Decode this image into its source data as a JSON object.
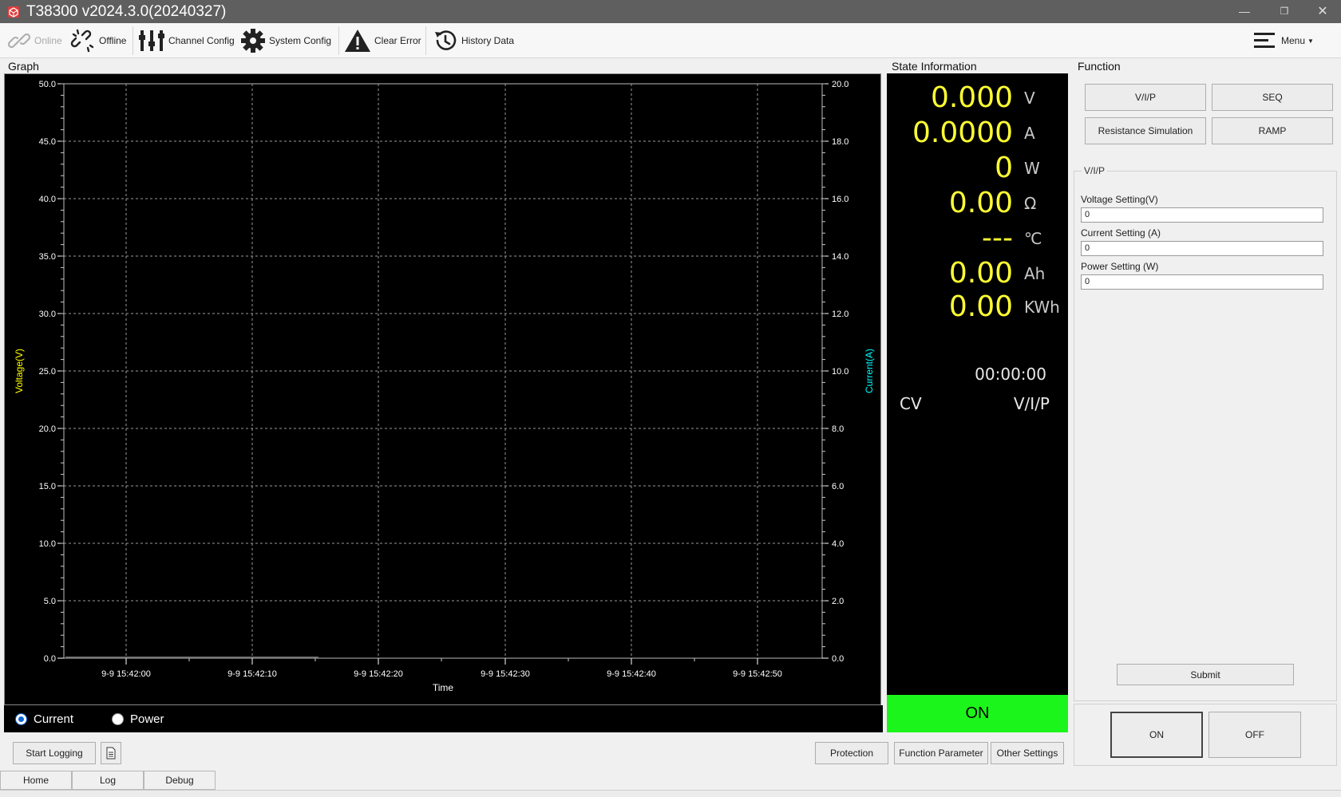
{
  "window": {
    "title": "T38300 v2024.3.0(20240327)",
    "controls": [
      "minimize-icon",
      "restore-icon",
      "close-icon"
    ]
  },
  "toolbar": {
    "online": "Online",
    "offline": "Offline",
    "channel_config": "Channel Config",
    "system_config": "System Config",
    "clear_error": "Clear Error",
    "history_data": "History Data",
    "menu": "Menu"
  },
  "sections": {
    "graph": "Graph",
    "state": "State Information",
    "function": "Function"
  },
  "chart_data": {
    "type": "line",
    "xlabel": "Time",
    "ylabel_left": "Voltage(V)",
    "ylabel_right": "Current(A)",
    "ylim_left": [
      0,
      50
    ],
    "ylim_right": [
      0,
      20
    ],
    "yticks_left": [
      "50.0",
      "45.0",
      "40.0",
      "35.0",
      "30.0",
      "25.0",
      "20.0",
      "15.0",
      "10.0",
      "5.0",
      "0.0"
    ],
    "yticks_right": [
      "20.0",
      "18.0",
      "16.0",
      "14.0",
      "12.0",
      "10.0",
      "8.0",
      "6.0",
      "4.0",
      "2.0",
      "0.0"
    ],
    "xticks": [
      "9-9 15:42:00",
      "9-9 15:42:10",
      "9-9 15:42:20",
      "9-9 15:42:30",
      "9-9 15:42:40",
      "9-9 15:42:50"
    ],
    "grid": true,
    "background": "#000000",
    "colors": {
      "voltage": "#ffff00",
      "current": "#00ffff",
      "axis": "#ffffff"
    }
  },
  "radio": {
    "current": "Current",
    "power": "Power",
    "selected": "current"
  },
  "state": {
    "voltage": {
      "value": "0.000",
      "unit": "V"
    },
    "current": {
      "value": "0.0000",
      "unit": "A"
    },
    "power": {
      "value": "0",
      "unit": "W"
    },
    "resistance": {
      "value": "0.00",
      "unit": "Ω"
    },
    "temperature": {
      "value": "---",
      "unit": "℃"
    },
    "capacity": {
      "value": "0.00",
      "unit": "Ah"
    },
    "energy": {
      "value": "0.00",
      "unit": "KWh"
    },
    "elapsed": "00:00:00",
    "mode": "CV",
    "function": "V/I/P",
    "output": "ON",
    "colors": {
      "value": "#ffff33",
      "output_on": "#1cf51c"
    }
  },
  "function": {
    "buttons": [
      "V/I/P",
      "SEQ",
      "Resistance Simulation",
      "RAMP"
    ],
    "group_title": "V/I/P",
    "fields": [
      {
        "label": "Voltage Setting(V)",
        "value": "0"
      },
      {
        "label": "Current Setting (A)",
        "value": "0"
      },
      {
        "label": "Power Setting (W)",
        "value": "0"
      }
    ],
    "submit": "Submit",
    "on": "ON",
    "off": "OFF"
  },
  "bottom": {
    "start_logging": "Start Logging",
    "protection": "Protection",
    "function_parameter": "Function Parameter",
    "other_settings": "Other Settings",
    "tabs": [
      "Home",
      "Log",
      "Debug"
    ]
  }
}
